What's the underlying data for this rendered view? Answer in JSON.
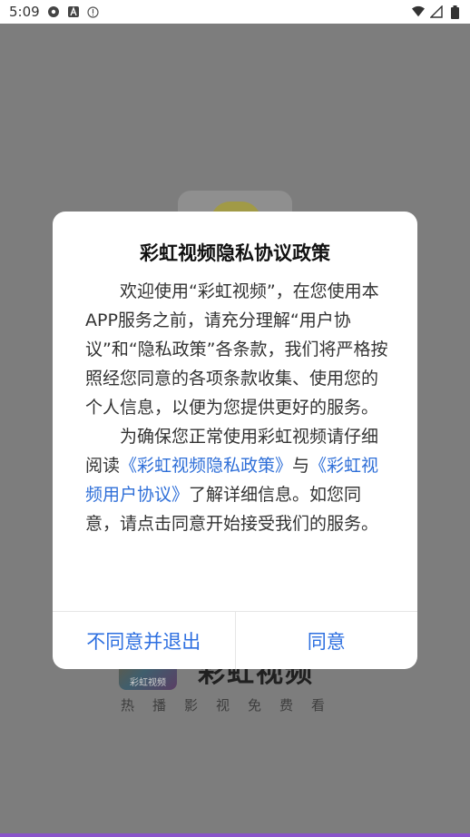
{
  "status_bar": {
    "time": "5:09",
    "icons_left": [
      "settings-icon",
      "text-a-icon",
      "info-icon"
    ],
    "icons_right": [
      "wifi-icon",
      "signal-icon",
      "battery-icon"
    ]
  },
  "background_app": {
    "logo_label": "彩虹视频",
    "title": "彩虹视频",
    "slogan": "热播影视免费看"
  },
  "dialog": {
    "title": "彩虹视频隐私协议政策",
    "paragraph1": "欢迎使用“彩虹视频”，在您使用本APP服务之前，请充分理解“用户协议”和“隐私政策”各条款，我们将严格按照经您同意的各项条款收集、使用您的个人信息，以便为您提供更好的服务。",
    "paragraph2_prefix": "为确保您正常使用彩虹视频请仔细阅读",
    "privacy_link": "《彩虹视频隐私政策》",
    "and_text": "与",
    "agreement_link": "《彩虹视频用户协议》",
    "paragraph2_suffix": "了解详细信息。如您同意，请点击同意开始接受我们的服务。",
    "disagree_button": "不同意并退出",
    "agree_button": "同意"
  },
  "colors": {
    "link": "#2f6fd8",
    "button": "#2d6fe0",
    "overlay": "#7d7d7d"
  }
}
